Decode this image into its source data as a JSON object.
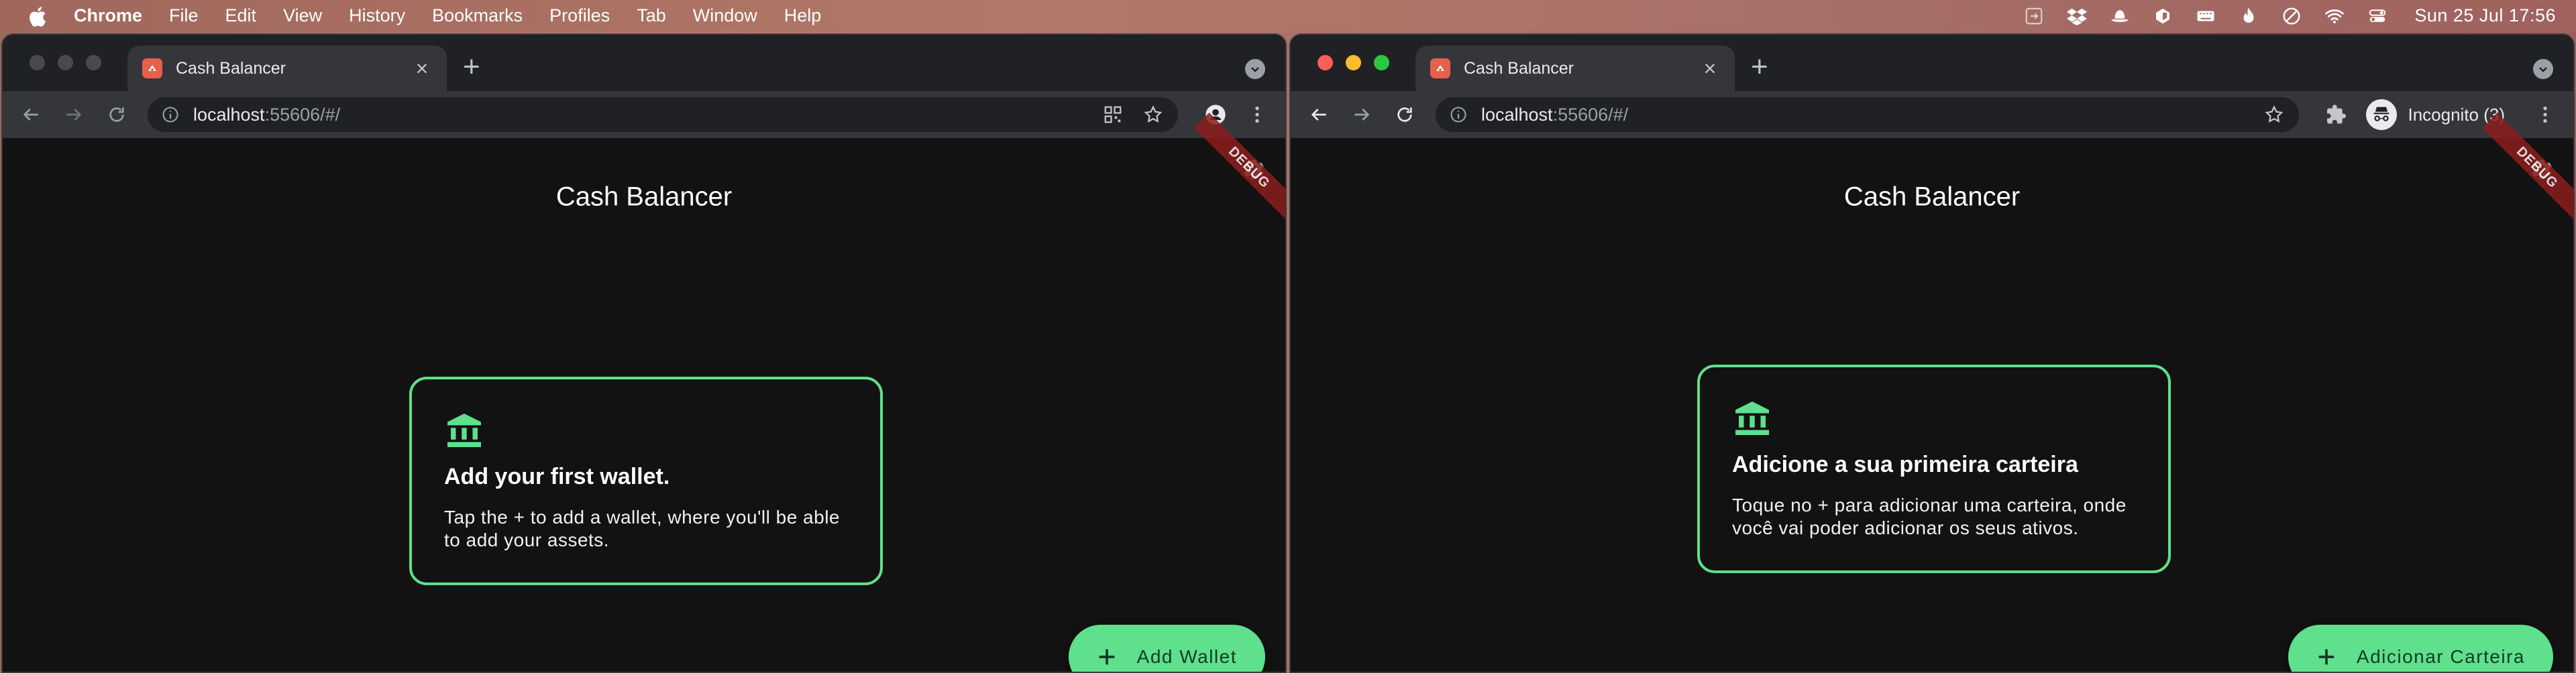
{
  "menubar": {
    "app_name": "Chrome",
    "items": [
      "File",
      "Edit",
      "View",
      "History",
      "Bookmarks",
      "Profiles",
      "Tab",
      "Window",
      "Help"
    ],
    "tray_icons": [
      "shortcut-icon",
      "dropbox-icon",
      "bowler-hat-icon",
      "extension-icon",
      "keyboard-icon",
      "flame-icon",
      "vpn-icon",
      "wifi-icon",
      "control-center-icon"
    ],
    "clock": "Sun 25 Jul  17:56"
  },
  "windows": {
    "left": {
      "tab": {
        "title": "Cash Balancer"
      },
      "url": {
        "host": "localhost",
        "rest": ":55606/#/"
      },
      "app": {
        "title": "Cash Balancer",
        "debug_banner": "DEBUG",
        "card_title": "Add your first wallet.",
        "card_body": "Tap the + to add a wallet, where you'll be able to add your assets.",
        "fab_label": "Add Wallet"
      }
    },
    "right": {
      "tab": {
        "title": "Cash Balancer"
      },
      "url": {
        "host": "localhost",
        "rest": ":55606/#/"
      },
      "incognito_label": "Incognito (3)",
      "app": {
        "title": "Cash Balancer",
        "debug_banner": "DEBUG",
        "card_title": "Adicione a sua primeira carteira",
        "card_body": "Toque no + para adicionar uma carteira, onde você vai poder adicionar os seus ativos.",
        "fab_label": "Adicionar Carteira"
      }
    }
  },
  "colors": {
    "accent": "#5ee08d",
    "app_background": "#121212",
    "tab_active": "#35363a",
    "debug_ribbon": "#8b1d1d"
  }
}
